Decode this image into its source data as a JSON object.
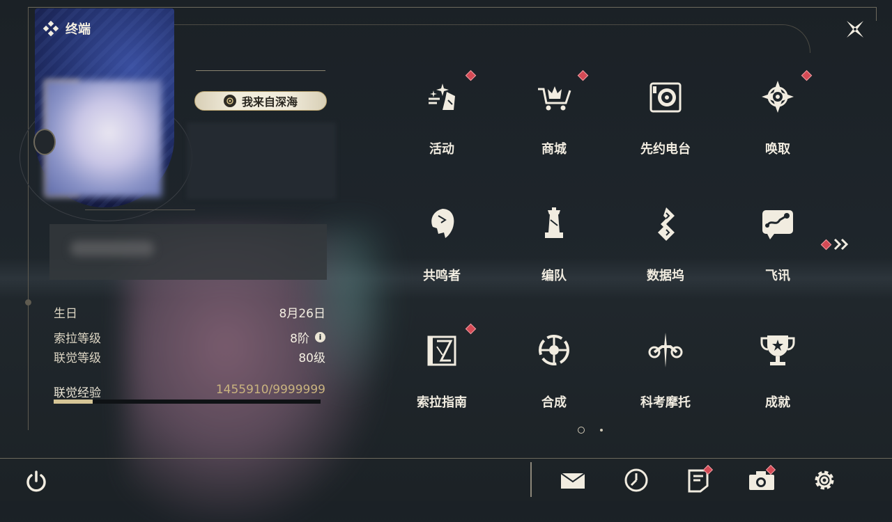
{
  "header": {
    "title": "终端"
  },
  "profile": {
    "nickname_badge": "我来自深海",
    "stats": [
      {
        "label": "生日",
        "value": "8月26日"
      },
      {
        "label": "索拉等级",
        "value": "8阶",
        "info": true
      },
      {
        "label": "联觉等级",
        "value": "80级"
      }
    ],
    "exp": {
      "label": "联觉经验",
      "value": "1455910/9999999",
      "progress": 0.1456
    }
  },
  "menu": [
    {
      "label": "活动",
      "icon": "event-icon",
      "notify": true
    },
    {
      "label": "商城",
      "icon": "shop-icon",
      "notify": true
    },
    {
      "label": "先约电台",
      "icon": "radio-icon",
      "notify": false
    },
    {
      "label": "唤取",
      "icon": "convene-icon",
      "notify": true
    },
    {
      "label": "共鸣者",
      "icon": "resonator-icon",
      "notify": false
    },
    {
      "label": "编队",
      "icon": "team-icon",
      "notify": false
    },
    {
      "label": "数据坞",
      "icon": "data-bank-icon",
      "notify": false
    },
    {
      "label": "飞讯",
      "icon": "message-icon",
      "notify": false
    },
    {
      "label": "索拉指南",
      "icon": "guide-icon",
      "notify": true
    },
    {
      "label": "合成",
      "icon": "synthesis-icon",
      "notify": false
    },
    {
      "label": "科考摩托",
      "icon": "motorcycle-icon",
      "notify": false
    },
    {
      "label": "成就",
      "icon": "achievement-icon",
      "notify": false
    }
  ],
  "pagination": {
    "current": 1,
    "total": 2
  },
  "colors": {
    "accent": "#d6c596",
    "notify": "#d44a55",
    "text": "#ece6d6"
  },
  "bottom_bar": [
    {
      "name": "mail",
      "icon": "mail-icon",
      "notify": false
    },
    {
      "name": "clock",
      "icon": "clock-icon",
      "notify": false
    },
    {
      "name": "notice",
      "icon": "notice-icon",
      "notify": true
    },
    {
      "name": "camera",
      "icon": "camera-icon",
      "notify": true
    },
    {
      "name": "settings",
      "icon": "gear-icon",
      "notify": false
    }
  ]
}
